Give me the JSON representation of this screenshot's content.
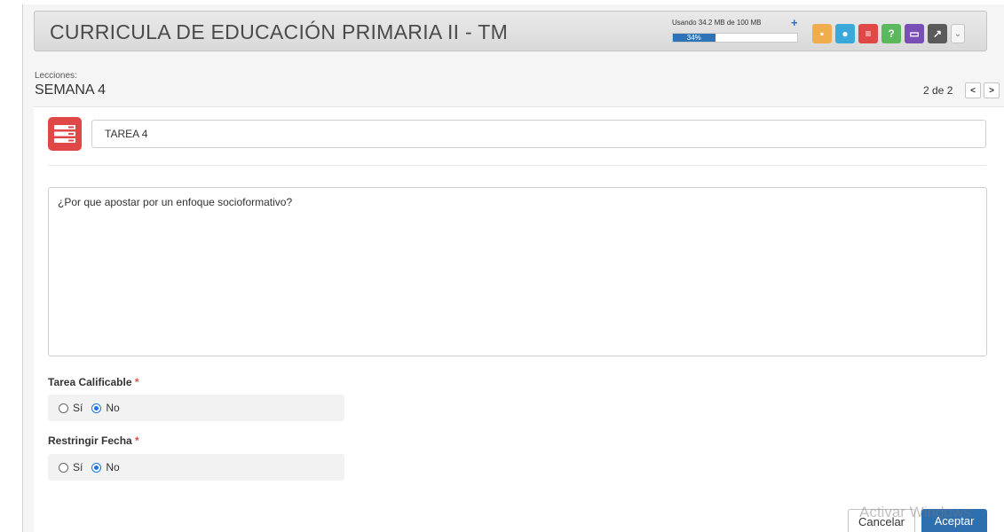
{
  "header": {
    "title": "CURRICULA DE EDUCACIÓN PRIMARIA II - TM",
    "usage_text": "Usando 34.2 MB de 100 MB",
    "usage_plus": "+",
    "usage_percent_label": "34%",
    "usage_fraction": 0.34,
    "toolbar": [
      {
        "name": "briefcase-icon",
        "color": "#f0ad4e",
        "glyph": "▪"
      },
      {
        "name": "chat-icon",
        "color": "#3aa8d8",
        "glyph": "●"
      },
      {
        "name": "task-list-icon",
        "color": "#e04848",
        "glyph": "≡"
      },
      {
        "name": "help-icon",
        "color": "#5cb85c",
        "glyph": "?"
      },
      {
        "name": "laptop-icon",
        "color": "#7a4fb5",
        "glyph": "▭"
      },
      {
        "name": "chart-icon",
        "color": "#5a5a5a",
        "glyph": "↗"
      }
    ],
    "caret_glyph": "⌄"
  },
  "lesson": {
    "label": "Lecciones:",
    "name": "SEMANA 4",
    "pager_text": "2 de 2",
    "prev_glyph": "<",
    "next_glyph": ">"
  },
  "task": {
    "title_value": "TAREA 4",
    "description": "¿Por que apostar por un enfoque socioformativo?"
  },
  "fields": {
    "graded_label": "Tarea Calificable",
    "restrict_label": "Restringir Fecha",
    "required_mark": "*",
    "option_yes": "Sí",
    "option_no": "No",
    "graded_selected": "No",
    "restrict_selected": "No"
  },
  "footer": {
    "cancel_label": "Cancelar",
    "accept_label": "Aceptar"
  },
  "watermark": "Activar Windows"
}
